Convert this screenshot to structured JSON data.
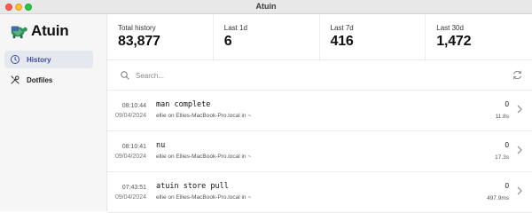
{
  "window": {
    "title": "Atuin"
  },
  "sidebar": {
    "logo_text": "Atuin",
    "items": [
      {
        "label": "History",
        "icon": "clock-icon",
        "active": true
      },
      {
        "label": "Dotfiles",
        "icon": "tools-icon",
        "active": false
      }
    ]
  },
  "stats": [
    {
      "label": "Total history",
      "value": "83,877"
    },
    {
      "label": "Last 1d",
      "value": "6"
    },
    {
      "label": "Last 7d",
      "value": "416"
    },
    {
      "label": "Last 30d",
      "value": "1,472"
    }
  ],
  "search": {
    "placeholder": "Search..."
  },
  "history": [
    {
      "time": "08:10:44",
      "date": "09/04/2024",
      "command": "man complete",
      "meta": "ellie on Ellies-MacBook-Pro.local in ~",
      "exit": "0",
      "duration": "11.8s"
    },
    {
      "time": "08:10:41",
      "date": "09/04/2024",
      "command": "nu",
      "meta": "ellie on Ellies-MacBook-Pro.local in ~",
      "exit": "0",
      "duration": "17.3s"
    },
    {
      "time": "07:43:51",
      "date": "09/04/2024",
      "command": "atuin store pull",
      "meta": "ellie on Ellies-MacBook-Pro.local in ~",
      "exit": "0",
      "duration": "497.9ms"
    }
  ],
  "colors": {
    "accent": "#3b4a9a",
    "active_bg": "#e6e8ef",
    "logo_green": "#2f8f5b"
  }
}
